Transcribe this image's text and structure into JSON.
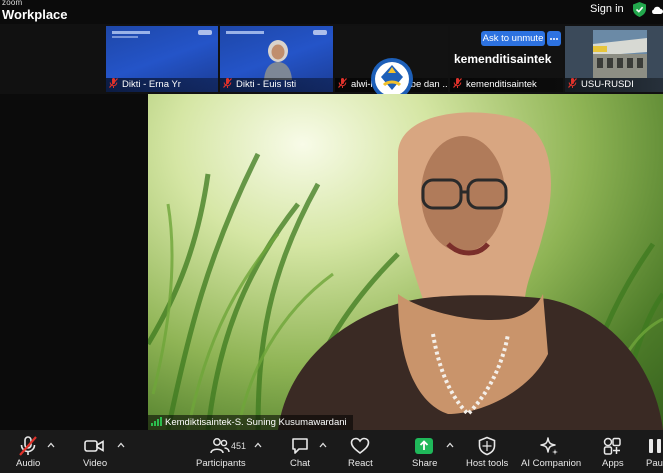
{
  "app": {
    "brand_small": "zoom",
    "brand_large": "Workplace",
    "signin_label": "Sign in"
  },
  "thumbnails": [
    {
      "name": "Dikti - Erna Yr",
      "kind": "slide"
    },
    {
      "name": "Dikti - Euis Isti",
      "kind": "slide-person"
    },
    {
      "name": "alwi-live youtube dan ...",
      "kind": "logo"
    },
    {
      "name": "kemenditisaintek",
      "kind": "name"
    },
    {
      "name": "USU-RUSDI",
      "kind": "building"
    }
  ],
  "active_card": {
    "display_name": "kemenditisaintek",
    "ask_unmute_label": "Ask to unmute"
  },
  "main_video": {
    "speaker_label": "Kemdiktisaintek-S. Suning Kusumawardani"
  },
  "toolbar": {
    "audio": "Audio",
    "video": "Video",
    "participants": "Participants",
    "participant_count": "451",
    "chat": "Chat",
    "react": "React",
    "share": "Share",
    "host_tools": "Host tools",
    "ai_companion": "AI Companion",
    "apps": "Apps",
    "pause": "Pau"
  },
  "colors": {
    "accent_blue": "#2d72e0",
    "share_green": "#1fb85a",
    "mute_red": "#e0322b",
    "shield_green": "#23a94d"
  }
}
